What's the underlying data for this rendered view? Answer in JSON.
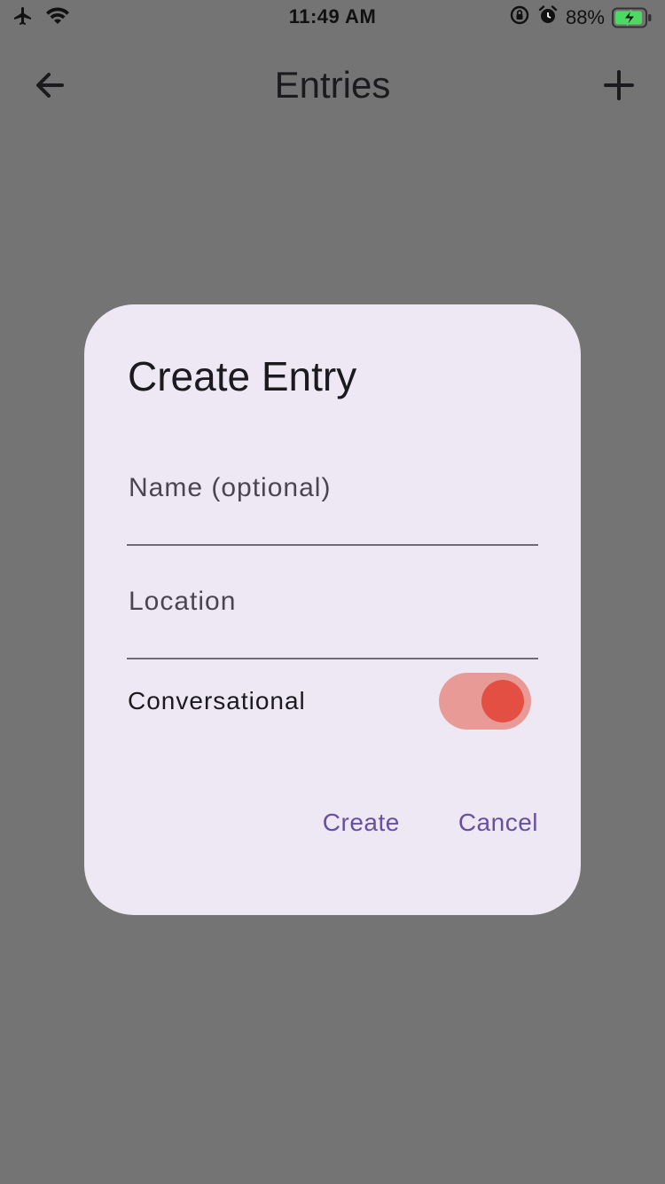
{
  "status_bar": {
    "time": "11:49 AM",
    "battery_percent": "88%",
    "icons": [
      "airplane-icon",
      "wifi-icon",
      "rotation-lock-icon",
      "alarm-icon",
      "battery-charging-icon"
    ]
  },
  "app_bar": {
    "title": "Entries",
    "back_icon": "arrow-left-icon",
    "add_icon": "plus-icon"
  },
  "dialog": {
    "title": "Create Entry",
    "name_field": {
      "placeholder": "Name (optional)",
      "value": ""
    },
    "location_field": {
      "placeholder": "Location",
      "value": ""
    },
    "toggle": {
      "label": "Conversational",
      "on": true
    },
    "actions": {
      "create_label": "Create",
      "cancel_label": "Cancel"
    }
  },
  "colors": {
    "scrim_background": "#747474",
    "dialog_surface": "#eee7f4",
    "action_text": "#6750a4",
    "switch_track": "#e79a96",
    "switch_thumb": "#e34f43",
    "underline": "#6f6a76"
  }
}
